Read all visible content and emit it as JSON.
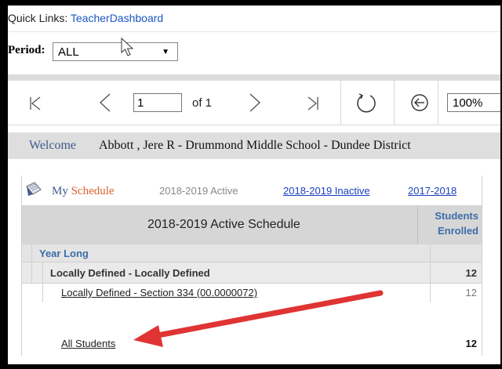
{
  "quick_links": {
    "label": "Quick Links:",
    "link": "TeacherDashboard"
  },
  "period": {
    "label": "Period:",
    "value": "ALL"
  },
  "toolbar": {
    "first_icon": "first-page-icon",
    "prev_icon": "previous-page-icon",
    "page_value": "1",
    "of_label": "of 1",
    "next_icon": "next-page-icon",
    "last_icon": "last-page-icon",
    "refresh_icon": "refresh-icon",
    "back_icon": "back-icon",
    "zoom_value": "100%"
  },
  "welcome": {
    "label": "Welcome",
    "text": "Abbott , Jere R - Drummond Middle School - Dundee District"
  },
  "schedule": {
    "icon": "schedule-icon",
    "my_label": "My",
    "schedule_label": "Schedule",
    "tabs": {
      "active": "2018-2019 Active",
      "inactive": "2018-2019 Inactive",
      "prior": "2017-2018"
    },
    "header": {
      "title": "2018-2019 Active Schedule",
      "students_line1": "Students",
      "students_line2": "Enrolled"
    },
    "rows": {
      "year_long": "Year Long",
      "locally_defined": {
        "label": "Locally Defined - Locally Defined",
        "count": "12"
      },
      "section": {
        "label": "Locally Defined - Section 334 (00.0000072)",
        "count": "12"
      },
      "all_students": {
        "label": "All Students",
        "count": "12"
      }
    }
  },
  "colors": {
    "link": "#1a55c4",
    "accent_orange": "#d9622b",
    "annotation_arrow": "#e03434"
  }
}
